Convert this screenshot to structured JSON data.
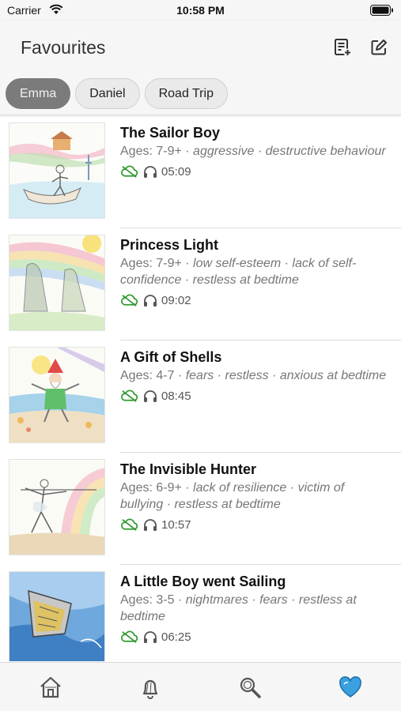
{
  "status_bar": {
    "carrier": "Carrier",
    "time": "10:58 PM"
  },
  "header": {
    "title": "Favourites"
  },
  "profiles": [
    {
      "label": "Emma",
      "active": true
    },
    {
      "label": "Daniel",
      "active": false
    },
    {
      "label": "Road Trip",
      "active": false
    }
  ],
  "stories": [
    {
      "title": "The Sailor Boy",
      "ages": "Ages: 7-9+ · ",
      "tags": "aggressive · destructive behaviour",
      "duration": "05:09",
      "icons": [
        "cloud-off-icon",
        "headphones-icon"
      ]
    },
    {
      "title": "Princess Light",
      "ages": "Ages: 7-9+ · ",
      "tags": "low self-esteem · lack of self-confidence · restless at bedtime",
      "duration": "09:02",
      "icons": [
        "cloud-off-icon",
        "headphones-icon"
      ]
    },
    {
      "title": "A Gift of Shells",
      "ages": "Ages: 4-7 · ",
      "tags": "fears · restless · anxious at bedtime",
      "duration": "08:45",
      "icons": [
        "cloud-off-icon",
        "headphones-icon"
      ]
    },
    {
      "title": "The Invisible Hunter",
      "ages": "Ages: 6-9+ · ",
      "tags": "lack of resilience · victim of bullying · restless at bedtime",
      "duration": "10:57",
      "icons": [
        "cloud-off-icon",
        "headphones-icon"
      ]
    },
    {
      "title": "A Little Boy went Sailing",
      "ages": "Ages: 3-5 · ",
      "tags": "nightmares · fears · restless at bedtime",
      "duration": "06:25",
      "icons": [
        "cloud-off-icon",
        "headphones-icon"
      ]
    }
  ],
  "tabbar": {
    "items": [
      "home-icon",
      "bell-icon",
      "search-icon",
      "favourites-heart-icon"
    ],
    "active": "favourites-heart-icon"
  },
  "colors": {
    "accent": "#3aa0e0",
    "download_green": "#2f9a2f",
    "chip_active": "#7b7b7b"
  }
}
